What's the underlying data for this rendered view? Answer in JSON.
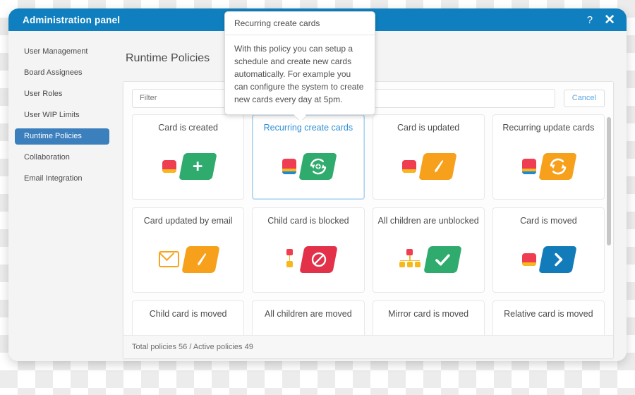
{
  "titlebar": {
    "title": "Administration panel",
    "help_icon": "question-mark-icon",
    "help_label": "?",
    "close_icon": "close-icon",
    "close_label": "✕",
    "background": "#0f7fbf"
  },
  "sidebar": {
    "items": [
      {
        "label": "User Management",
        "active": false
      },
      {
        "label": "Board Assignees",
        "active": false
      },
      {
        "label": "User Roles",
        "active": false
      },
      {
        "label": "User WIP Limits",
        "active": false
      },
      {
        "label": "Runtime Policies",
        "active": true
      },
      {
        "label": "Collaboration",
        "active": false
      },
      {
        "label": "Email Integration",
        "active": false
      }
    ],
    "active_color": "#3c7fbd"
  },
  "main": {
    "page_title": "Runtime Policies",
    "filter_placeholder": "Filter",
    "filter_value": "",
    "cancel_label": "Cancel",
    "footer_text": "Total policies 56 / Active policies 49"
  },
  "tooltip": {
    "title": "Recurring create cards",
    "body": "With this policy you can setup a schedule and create new cards automatically. For example you can configure the system to create new cards every day at 5pm."
  },
  "policies": [
    {
      "title": "Card is created",
      "badge": "single-card-icon",
      "shape": "green",
      "glyph": "plus-icon",
      "selected": false
    },
    {
      "title": "Recurring create cards",
      "badge": "stacked-cards-icon",
      "shape": "green",
      "glyph": "recurring-add-icon",
      "selected": true
    },
    {
      "title": "Card is updated",
      "badge": "single-card-icon",
      "shape": "orange",
      "glyph": "pencil-icon",
      "selected": false
    },
    {
      "title": "Recurring update cards",
      "badge": "stacked-cards-icon",
      "shape": "orange",
      "glyph": "refresh-icon",
      "selected": false
    },
    {
      "title": "Card updated by email",
      "badge": "envelope-icon",
      "shape": "orange",
      "glyph": "pencil-icon",
      "selected": false
    },
    {
      "title": "Child card is blocked",
      "badge": "child-card-icon",
      "shape": "red",
      "glyph": "block-icon",
      "selected": false
    },
    {
      "title": "All children are unblocked",
      "badge": "children-cards-icon",
      "shape": "green",
      "glyph": "check-icon",
      "selected": false
    },
    {
      "title": "Card is moved",
      "badge": "single-card-icon",
      "shape": "blue",
      "glyph": "chevron-right-icon",
      "selected": false
    },
    {
      "title": "Child card is moved",
      "badge": "child-card-icon",
      "shape": "blue",
      "glyph": "chevron-right-icon",
      "selected": false
    },
    {
      "title": "All children are moved",
      "badge": "children-cards-icon",
      "shape": "blue",
      "glyph": "chevron-right-icon",
      "selected": false
    },
    {
      "title": "Mirror card is moved",
      "badge": "mirror-card-icon",
      "shape": "blue",
      "glyph": "chevron-right-icon",
      "selected": false
    },
    {
      "title": "Relative card is moved",
      "badge": "relative-card-icon",
      "shape": "blue",
      "glyph": "chevron-right-icon",
      "selected": false
    }
  ],
  "colors": {
    "accent_blue": "#0f7fbf",
    "card_red": "#ef3e52",
    "card_yellow": "#f6b81c",
    "green": "#2fab6e",
    "orange": "#f6a01c",
    "red": "#e23149",
    "blue": "#127cba",
    "selected_border": "#a9d3ef"
  }
}
